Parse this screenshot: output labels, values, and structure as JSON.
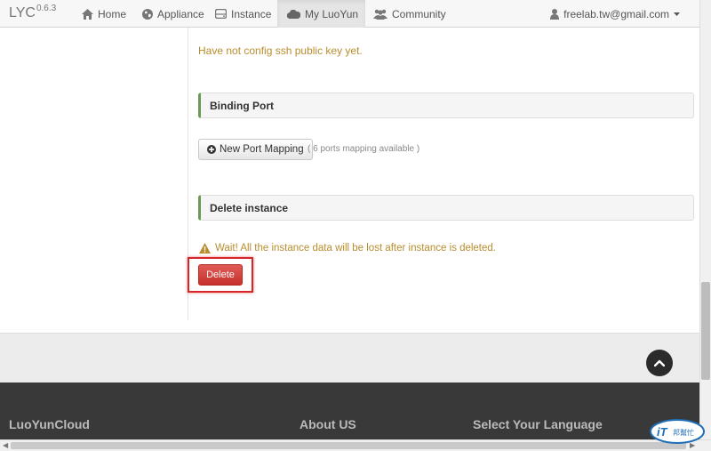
{
  "navbar": {
    "brand": "LYC",
    "version": "0.6.3",
    "items": [
      {
        "label": "Home",
        "icon": "home-icon"
      },
      {
        "label": "Appliance",
        "icon": "globe-icon"
      },
      {
        "label": "Instance",
        "icon": "hdd-icon"
      },
      {
        "label": "My LuoYun",
        "icon": "cloud-icon",
        "active": true
      },
      {
        "label": "Community",
        "icon": "group-icon"
      }
    ],
    "user": "freelab.tw@gmail.com"
  },
  "main": {
    "ssh_message": "Have not config ssh public key yet.",
    "binding_port": {
      "title": "Binding Port",
      "button_label": "New Port Mapping",
      "note": "( 6 ports mapping available )"
    },
    "delete_instance": {
      "title": "Delete instance",
      "warning": "Wait! All the instance data will be lost after instance is deleted.",
      "button_label": "Delete"
    }
  },
  "footer": {
    "col1": "LuoYunCloud",
    "col2": "About US",
    "col3": "Select Your Language"
  },
  "watermark": {
    "brand": "iT",
    "text": "邦幫忙"
  },
  "colors": {
    "warning_text": "#b98d2f",
    "danger": "#d9534f",
    "section_accent": "#6a9a55",
    "footer_bg": "#393939"
  }
}
